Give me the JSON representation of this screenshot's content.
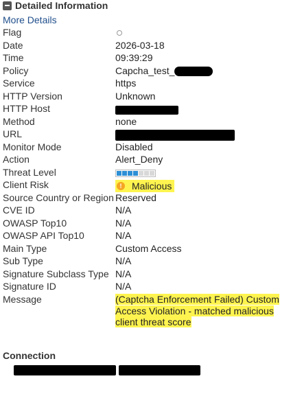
{
  "header": {
    "title": "Detailed Information",
    "collapse_icon": "minus-square-icon"
  },
  "more_details": "More Details",
  "fields": {
    "flag": {
      "label": "Flag"
    },
    "date": {
      "label": "Date",
      "value": "2026-03-18"
    },
    "time": {
      "label": "Time",
      "value": "09:39:29"
    },
    "policy": {
      "label": "Policy",
      "value": "Capcha_test_"
    },
    "service": {
      "label": "Service",
      "value": "https"
    },
    "http_version": {
      "label": "HTTP Version",
      "value": "Unknown"
    },
    "http_host": {
      "label": "HTTP Host"
    },
    "method": {
      "label": "Method",
      "value": "none"
    },
    "url": {
      "label": "URL"
    },
    "monitor_mode": {
      "label": "Monitor Mode",
      "value": "Disabled"
    },
    "action": {
      "label": "Action",
      "value": "Alert_Deny"
    },
    "threat_level": {
      "label": "Threat Level",
      "segments_filled": 4,
      "segments_total": 7
    },
    "client_risk": {
      "label": "Client Risk",
      "value": "Malicious",
      "highlight": "#fff44f",
      "icon": "warning-icon"
    },
    "source_country": {
      "label": "Source Country or Region",
      "value": "Reserved"
    },
    "cve_id": {
      "label": "CVE ID",
      "value": "N/A"
    },
    "owasp_top10": {
      "label": "OWASP Top10",
      "value": "N/A"
    },
    "owasp_api": {
      "label": "OWASP API Top10",
      "value": "N/A"
    },
    "main_type": {
      "label": "Main Type",
      "value": "Custom Access"
    },
    "sub_type": {
      "label": "Sub Type",
      "value": "N/A"
    },
    "sig_subclass": {
      "label": "Signature Subclass Type",
      "value": "N/A"
    },
    "sig_id": {
      "label": "Signature ID",
      "value": "N/A"
    },
    "message": {
      "label": "Message",
      "value": "(Captcha Enforcement Failed) Custom Access Violation - matched malicious client threat score"
    }
  },
  "connection": {
    "title": "Connection"
  },
  "colors": {
    "threat_on": "#2d8fd5",
    "threat_off": "#d8d8d8",
    "link": "#1f4e8c",
    "warning": "#f5a623"
  }
}
